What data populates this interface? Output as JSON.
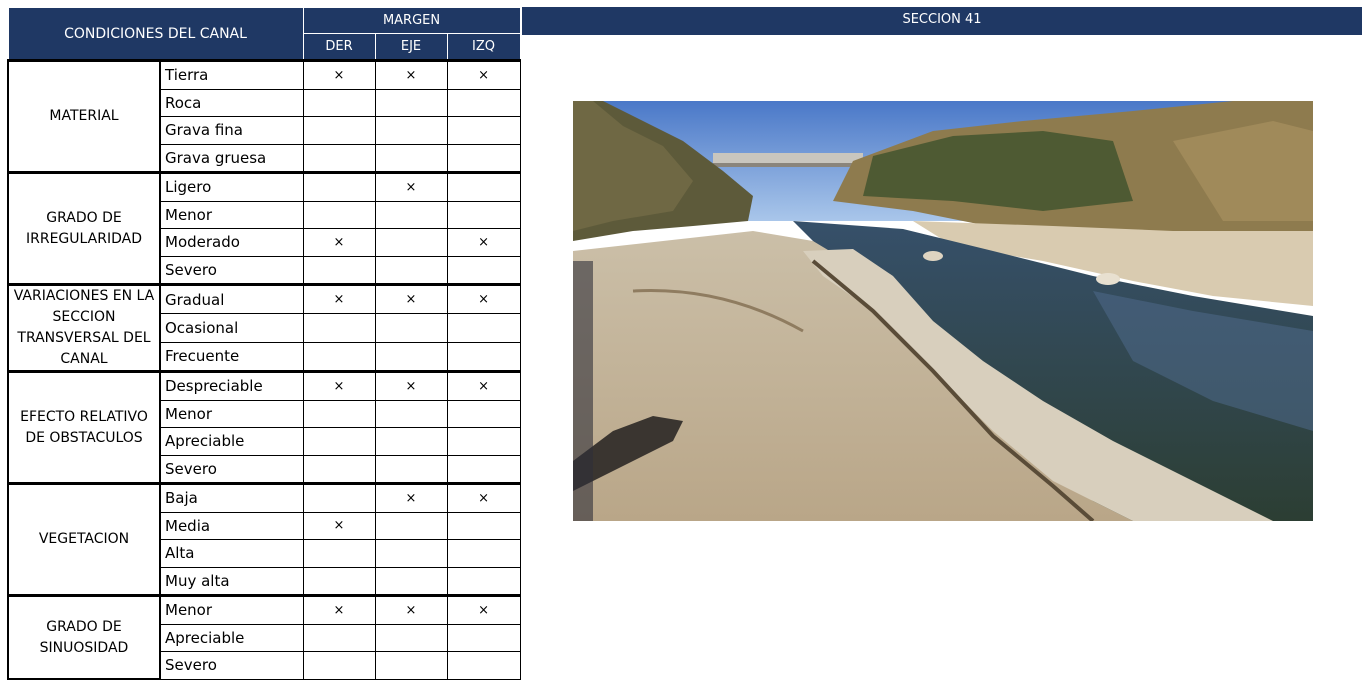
{
  "header": {
    "conditions": "CONDICIONES DEL CANAL",
    "margen": "MARGEN",
    "der": "DER",
    "eje": "EJE",
    "izq": "IZQ",
    "section": "SECCION 41"
  },
  "mark_symbol": "×",
  "groups": [
    {
      "name": "MATERIAL",
      "rows": [
        {
          "label": "Tierra",
          "der": "×",
          "eje": "×",
          "izq": "×"
        },
        {
          "label": "Roca",
          "der": "",
          "eje": "",
          "izq": ""
        },
        {
          "label": "Grava fina",
          "der": "",
          "eje": "",
          "izq": ""
        },
        {
          "label": "Grava gruesa",
          "der": "",
          "eje": "",
          "izq": ""
        }
      ]
    },
    {
      "name": "GRADO DE IRREGULARIDAD",
      "rows": [
        {
          "label": "Ligero",
          "der": "",
          "eje": "×",
          "izq": ""
        },
        {
          "label": "Menor",
          "der": "",
          "eje": "",
          "izq": ""
        },
        {
          "label": "Moderado",
          "der": "×",
          "eje": "",
          "izq": "×"
        },
        {
          "label": "Severo",
          "der": "",
          "eje": "",
          "izq": ""
        }
      ]
    },
    {
      "name": "VARIACIONES EN LA SECCION TRANSVERSAL DEL CANAL",
      "rows": [
        {
          "label": "Gradual",
          "der": "×",
          "eje": "×",
          "izq": "×"
        },
        {
          "label": "Ocasional",
          "der": "",
          "eje": "",
          "izq": ""
        },
        {
          "label": "Frecuente",
          "der": "",
          "eje": "",
          "izq": ""
        }
      ]
    },
    {
      "name": "EFECTO RELATIVO DE OBSTACULOS",
      "rows": [
        {
          "label": "Despreciable",
          "der": "×",
          "eje": "×",
          "izq": "×"
        },
        {
          "label": "Menor",
          "der": "",
          "eje": "",
          "izq": ""
        },
        {
          "label": "Apreciable",
          "der": "",
          "eje": "",
          "izq": ""
        },
        {
          "label": "Severo",
          "der": "",
          "eje": "",
          "izq": ""
        }
      ]
    },
    {
      "name": "VEGETACION",
      "rows": [
        {
          "label": "Baja",
          "der": "",
          "eje": "×",
          "izq": "×"
        },
        {
          "label": "Media",
          "der": "×",
          "eje": "",
          "izq": ""
        },
        {
          "label": "Alta",
          "der": "",
          "eje": "",
          "izq": ""
        },
        {
          "label": "Muy alta",
          "der": "",
          "eje": "",
          "izq": ""
        }
      ]
    },
    {
      "name": "GRADO DE SINUOSIDAD",
      "rows": [
        {
          "label": "Menor",
          "der": "×",
          "eje": "×",
          "izq": "×"
        },
        {
          "label": "Apreciable",
          "der": "",
          "eje": "",
          "izq": ""
        },
        {
          "label": "Severo",
          "der": "",
          "eje": "",
          "izq": ""
        }
      ]
    }
  ],
  "colors": {
    "header_bg": "#1f3864",
    "header_text": "#ffffff"
  }
}
